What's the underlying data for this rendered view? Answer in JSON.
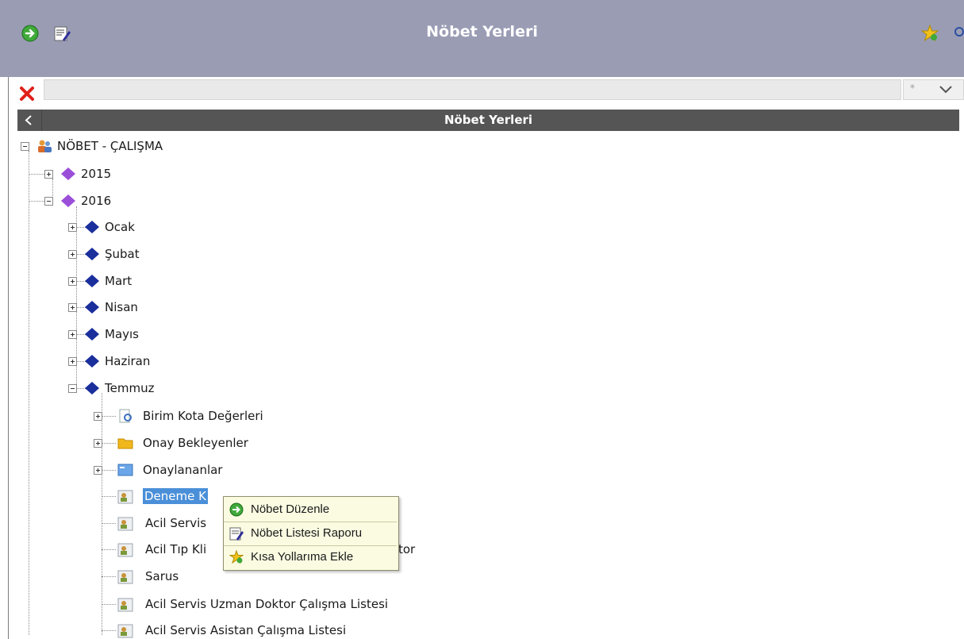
{
  "header": {
    "title": "Nöbet Yerleri",
    "left_icons": [
      "arrow-right-icon",
      "edit-note-icon"
    ],
    "right_icons": [
      "star-add-icon",
      "search-icon"
    ]
  },
  "filter": {
    "value": "",
    "star_text": "*"
  },
  "panel": {
    "title": "Nöbet Yerleri"
  },
  "tree": {
    "root": {
      "label": "NÖBET - ÇALIŞMA",
      "icon": "people-icon"
    },
    "years": [
      {
        "label": "2015",
        "expanded": false
      },
      {
        "label": "2016",
        "expanded": true
      }
    ],
    "months": [
      {
        "label": "Ocak"
      },
      {
        "label": "Şubat"
      },
      {
        "label": "Mart"
      },
      {
        "label": "Nisan"
      },
      {
        "label": "Mayıs"
      },
      {
        "label": "Haziran"
      },
      {
        "label": "Temmuz"
      }
    ],
    "temmuz_children": [
      {
        "label": "Birim Kota Değerleri",
        "icon": "document-search-icon"
      },
      {
        "label": "Onay Bekleyenler",
        "icon": "folder-icon"
      },
      {
        "label": "Onaylananlar",
        "icon": "folder-blue-icon"
      },
      {
        "label": "Deneme K",
        "icon": "person-card-icon",
        "selected": true
      },
      {
        "label": "Acil Servis",
        "icon": "person-card-icon"
      },
      {
        "label": "Acil Tıp Kli",
        "label_tail": "tor",
        "icon": "person-card-icon"
      },
      {
        "label": "Sarus",
        "icon": "person-card-icon"
      },
      {
        "label": "Acil Servis Uzman Doktor Çalışma Listesi",
        "icon": "person-card-icon"
      },
      {
        "label": "Acil Servis Asistan Çalışma Listesi",
        "icon": "person-card-icon"
      }
    ]
  },
  "context_menu": {
    "items": [
      {
        "label": "Nöbet Düzenle",
        "icon": "arrow-right-icon"
      },
      {
        "label": "Nöbet Listesi Raporu",
        "icon": "report-icon"
      },
      {
        "label": "Kısa Yollarıma Ekle",
        "icon": "star-add-icon"
      }
    ]
  },
  "colors": {
    "header_bg": "#9a9cb4",
    "panel_bar_bg": "#555555",
    "selection": "#4a8fd8",
    "menu_bg": "#fbfbe2",
    "year_diamond": "#9b4fd9",
    "month_diamond": "#1a2e9c"
  }
}
